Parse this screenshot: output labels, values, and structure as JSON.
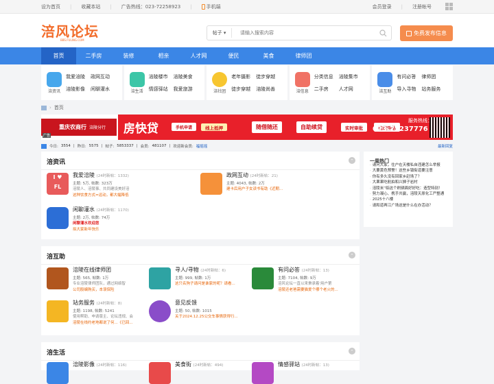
{
  "topbar": {
    "left": [
      "设为首页",
      "收藏本站",
      "广告热线：023-72258923",
      "手机端"
    ],
    "right": [
      "会员登录",
      "注册帐号"
    ]
  },
  "header": {
    "logo": "涪风论坛",
    "logo_sub": "BBS.FULING.COM",
    "search_category": "帖子",
    "search_placeholder": "请输入搜索内容",
    "post_button": "免费发布信息"
  },
  "nav": [
    "首页",
    "二手房",
    "装修",
    "相亲",
    "人才网",
    "便民",
    "美食",
    "律师团"
  ],
  "quick": [
    {
      "label": "涪资讯",
      "links": [
        "我爱涪陵",
        "政网互动",
        "涪陵影像",
        "闲聊灌水"
      ],
      "color": "#47a7ec"
    },
    {
      "label": "涪生活",
      "links": [
        "涪陵楼市",
        "涪陵美食",
        "情感驿站",
        "我爱旅游"
      ],
      "color": "#3cc6a7"
    },
    {
      "label": "涪社团",
      "links": [
        "老年摄影",
        "徒步穿越",
        "徒步穿越",
        "涪陵尚善"
      ],
      "color": "#f7c630"
    },
    {
      "label": "涪信息",
      "links": [
        "分类信息",
        "涪陵集市",
        "二手房",
        "人才网"
      ],
      "color": "#f07265"
    },
    {
      "label": "涪互助",
      "links": [
        "有问必答",
        "律师团",
        "导入寻物",
        "站务服务"
      ],
      "color": "#4a8de8"
    }
  ],
  "breadcrumb": "首页",
  "ad": {
    "brand": "重庆农商行",
    "brand_sub": "涪陵分行",
    "tag": "广告",
    "main": "房快贷",
    "pills": [
      "手机申请",
      "线上抵押",
      "随借随还",
      "自助续贷",
      "实时审批",
      "远程评估"
    ],
    "hotline_label": "服务热线：",
    "hotline": "023-72237776"
  },
  "stats": {
    "today_label": "今日:",
    "today": "3554",
    "yesterday_label": "昨日:",
    "yesterday": "5575",
    "posts_label": "帖子:",
    "posts": "5853337",
    "members_label": "会员:",
    "members": "481107",
    "welcome_label": "欢迎新会员:",
    "newest": "福摇摇",
    "latest_reply": "最新回复"
  },
  "sections": [
    {
      "title": "涪资讯",
      "forums": [
        {
          "name": "我爱涪陵",
          "new": "(24时新帖：1332)",
          "stat": "主题: 5万, 帖数: 323万",
          "desc": "涪陵人、涪陵事、共同建设美好涪",
          "last": "这种饮食方式=运动，都大幅降低",
          "color": "#e85b5b"
        },
        {
          "name": "政网互动",
          "new": "(24时新帖：21)",
          "stat": "主题: 4043, 帖数: 2万",
          "desc": "",
          "last": "建卡后用户子女读书有助《近期...",
          "color": "#f5913a"
        },
        {
          "name": "闲聊灌水",
          "new": "(24时新帖：1170)",
          "stat": "主题: 2万, 帖数: 74万",
          "desc": "闲聊灌水欢迎您",
          "last": "拟大家新年快乐",
          "color": "#2c6ed6"
        }
      ]
    },
    {
      "title": "涪互助",
      "forums": [
        {
          "name": "涪陵在线律师团",
          "new": "",
          "stat": "主题: 565, 帖数: 1万",
          "desc": "专业涪陵律师团队，通过网络智",
          "last": "公司股编购买，本误保险",
          "color": "#b1561e"
        },
        {
          "name": "寻人/寻物",
          "new": "(24时新帖：6)",
          "stat": "主题: 999, 帖数: 1万",
          "desc": "",
          "last": "这只名狗子请问是谁家的呢？请看...",
          "color": "#2ea3a3"
        },
        {
          "name": "有问必答",
          "new": "(24时新帖：13)",
          "stat": "主题: 7104, 帖数: 9万",
          "desc": "涪风论坛一直以来秉承着'用户第",
          "last": "涪陵还老爸需要猫爱个哪个老火的...",
          "color": "#2a8a3a"
        },
        {
          "name": "站务服务",
          "new": "(24时新帖：8)",
          "stat": "主题: 1198, 帖数: 5241",
          "desc": "使用帮助、申请版主、论坛违规、会",
          "last": "涪陵在线约老地都说了何...《已回...",
          "color": "#f4b623"
        },
        {
          "name": "意见反馈",
          "new": "",
          "stat": "主题: 50, 帖数: 1015",
          "desc": "",
          "last": "关于2024.12.25公交车事情获得行...",
          "color": "#8a4dc9"
        }
      ]
    },
    {
      "title": "涪生活",
      "forums": [
        {
          "name": "涪陵影像",
          "new": "(24时新帖：116)",
          "color": "#3b86e6"
        },
        {
          "name": "美食街",
          "new": "(24时新帖：494)",
          "color": "#e84a4a"
        },
        {
          "name": "情感驿站",
          "new": "(24时新帖：13)",
          "color": "#b449c4"
        }
      ]
    }
  ],
  "hot": {
    "title": "一周热门",
    "items": [
      "请问大家，住户在天楼私自违建怎么举报",
      "大要黄色预警！这些乡镇街道要注意",
      "你有多久没有回家乡赶场了？",
      "大果果吃航拍和兴狮子岩村",
      "涪陵米“临这个刷辆面好好吃：造型特别！",
      "努力凝心、携手共赢，涪陵天原化工严整通",
      "2025十八楼",
      "请和道再江广场这是什么在办活动？"
    ]
  }
}
